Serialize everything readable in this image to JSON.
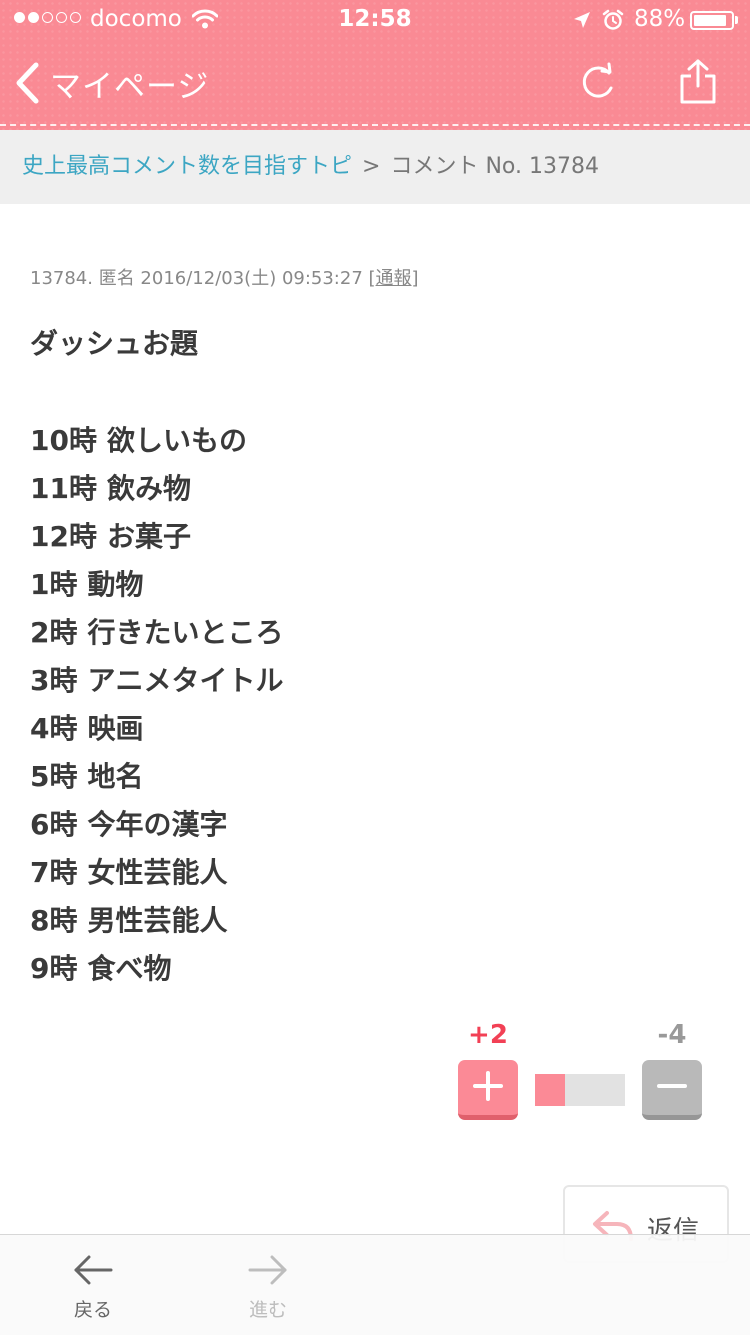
{
  "status_bar": {
    "carrier": "docomo",
    "time": "12:58",
    "battery": "88%",
    "battery_level": 0.88,
    "signal_bars_filled": 2,
    "signal_bars_total": 5
  },
  "header": {
    "back_label": "マイページ",
    "back_icon": "chevron-left-icon",
    "refresh_icon": "refresh-icon",
    "share_icon": "share-icon",
    "background_color": "#fa8a94"
  },
  "breadcrumb": {
    "parent": "史上最高コメント数を目指すトピ",
    "separator": ">",
    "current": "コメント No. 13784"
  },
  "comment": {
    "meta_prefix": "13784. 匿名 2016/12/03(土) 09:53:27 [",
    "report_label": "通報",
    "meta_suffix": "]",
    "title": "ダッシュお題",
    "items": [
      {
        "hour": "10時",
        "topic": "欲しいもの"
      },
      {
        "hour": "11時",
        "topic": "飲み物"
      },
      {
        "hour": "12時",
        "topic": "お菓子"
      },
      {
        "hour": "1時",
        "topic": "動物"
      },
      {
        "hour": "2時",
        "topic": "行きたいところ"
      },
      {
        "hour": "3時",
        "topic": "アニメタイトル"
      },
      {
        "hour": "4時",
        "topic": "映画"
      },
      {
        "hour": "5時",
        "topic": "地名"
      },
      {
        "hour": "6時",
        "topic": "今年の漢字"
      },
      {
        "hour": "7時",
        "topic": "女性芸能人"
      },
      {
        "hour": "8時",
        "topic": "男性芸能人"
      },
      {
        "hour": "9時",
        "topic": "食べ物"
      }
    ]
  },
  "votes": {
    "plus": "+2",
    "minus": "-4",
    "plus_ratio": 0.333,
    "plus_color": "#f24055",
    "minus_color": "#999999"
  },
  "reply": {
    "label": "返信",
    "icon": "reply-arrow-icon"
  },
  "toolbar": {
    "back_label": "戻る",
    "forward_label": "進む",
    "back_icon": "arrow-left-icon",
    "forward_icon": "arrow-right-icon"
  }
}
